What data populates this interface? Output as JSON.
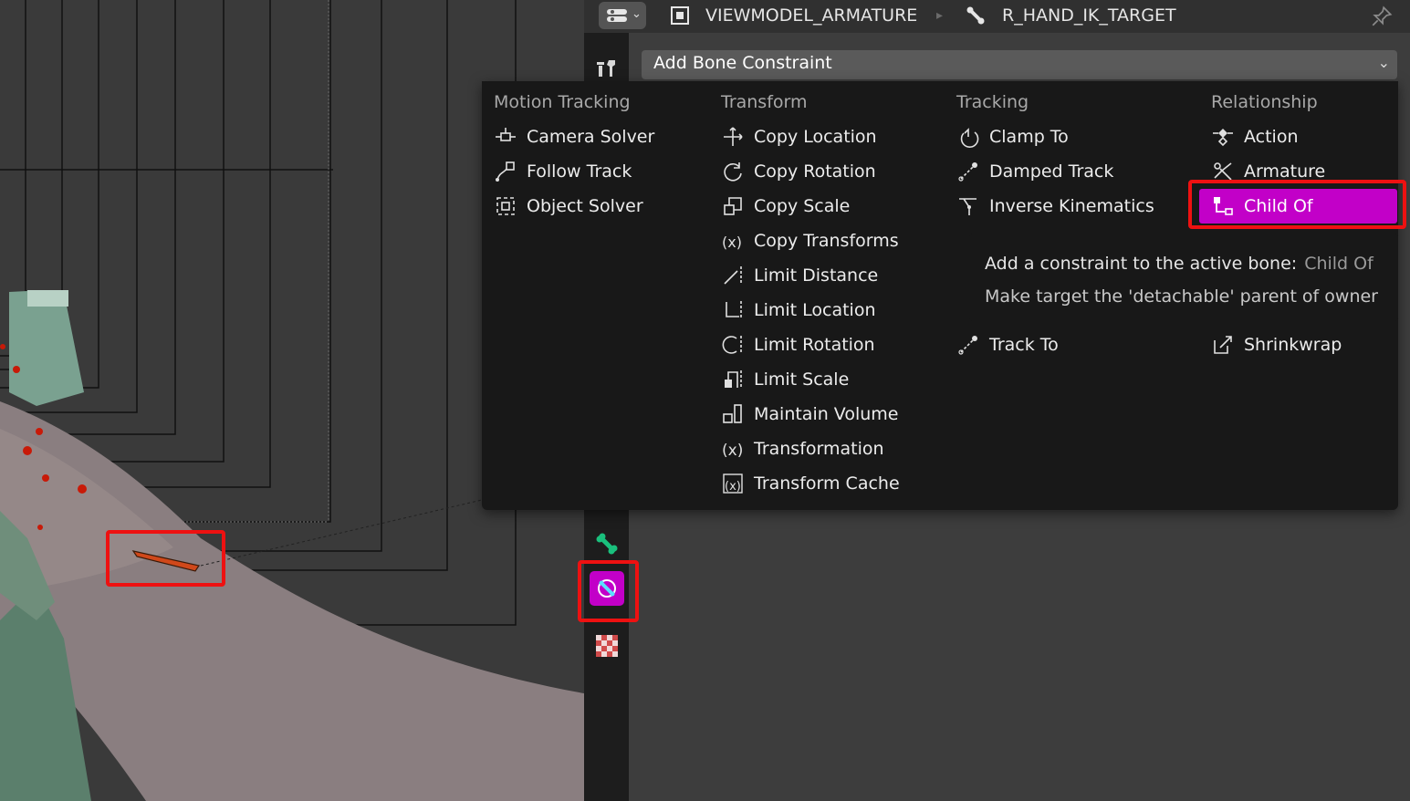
{
  "header": {
    "armature_name": "VIEWMODEL_ARMATURE",
    "bone_name": "R_HAND_IK_TARGET",
    "editor_type_icon": "properties-editor-icon",
    "pin_icon": "pin-icon"
  },
  "tabs": [
    {
      "name": "tool",
      "icon": "tool-icon"
    },
    {
      "name": "bone",
      "icon": "bone-icon"
    },
    {
      "name": "bone-constraints",
      "icon": "bone-constraint-icon",
      "active": true
    },
    {
      "name": "texture",
      "icon": "checker-texture-icon"
    }
  ],
  "add_constraint": {
    "label": "Add Bone Constraint"
  },
  "menu": {
    "columns": [
      {
        "title": "Motion Tracking",
        "items": [
          {
            "label": "Camera Solver",
            "icon": "camera-solver-icon"
          },
          {
            "label": "Follow Track",
            "icon": "follow-track-icon"
          },
          {
            "label": "Object Solver",
            "icon": "object-solver-icon"
          }
        ]
      },
      {
        "title": "Transform",
        "items": [
          {
            "label": "Copy Location",
            "icon": "copy-location-icon"
          },
          {
            "label": "Copy Rotation",
            "icon": "copy-rotation-icon"
          },
          {
            "label": "Copy Scale",
            "icon": "copy-scale-icon"
          },
          {
            "label": "Copy Transforms",
            "icon": "copy-transforms-icon"
          },
          {
            "label": "Limit Distance",
            "icon": "limit-distance-icon"
          },
          {
            "label": "Limit Location",
            "icon": "limit-location-icon"
          },
          {
            "label": "Limit Rotation",
            "icon": "limit-rotation-icon"
          },
          {
            "label": "Limit Scale",
            "icon": "limit-scale-icon"
          },
          {
            "label": "Maintain Volume",
            "icon": "maintain-volume-icon"
          },
          {
            "label": "Transformation",
            "icon": "transformation-icon"
          },
          {
            "label": "Transform Cache",
            "icon": "transform-cache-icon"
          }
        ]
      },
      {
        "title": "Tracking",
        "items": [
          {
            "label": "Clamp To",
            "icon": "clamp-to-icon"
          },
          {
            "label": "Damped Track",
            "icon": "damped-track-icon"
          },
          {
            "label": "Inverse Kinematics",
            "icon": "inverse-kinematics-icon"
          },
          {
            "label": "Track To",
            "icon": "track-to-icon"
          }
        ]
      },
      {
        "title": "Relationship",
        "items": [
          {
            "label": "Action",
            "icon": "action-icon"
          },
          {
            "label": "Armature",
            "icon": "armature-icon"
          },
          {
            "label": "Child Of",
            "icon": "child-of-icon",
            "active": true
          },
          {
            "label": "Shrinkwrap",
            "icon": "shrinkwrap-icon"
          }
        ]
      }
    ]
  },
  "tooltip": {
    "line1": "Add a constraint to the active bone:",
    "line1_name": "Child Of",
    "line2": "Make target the 'detachable' parent of owner"
  },
  "colors": {
    "accent": "#c200c8",
    "highlight_box": "#ee1111",
    "menu_bg": "#181818"
  }
}
